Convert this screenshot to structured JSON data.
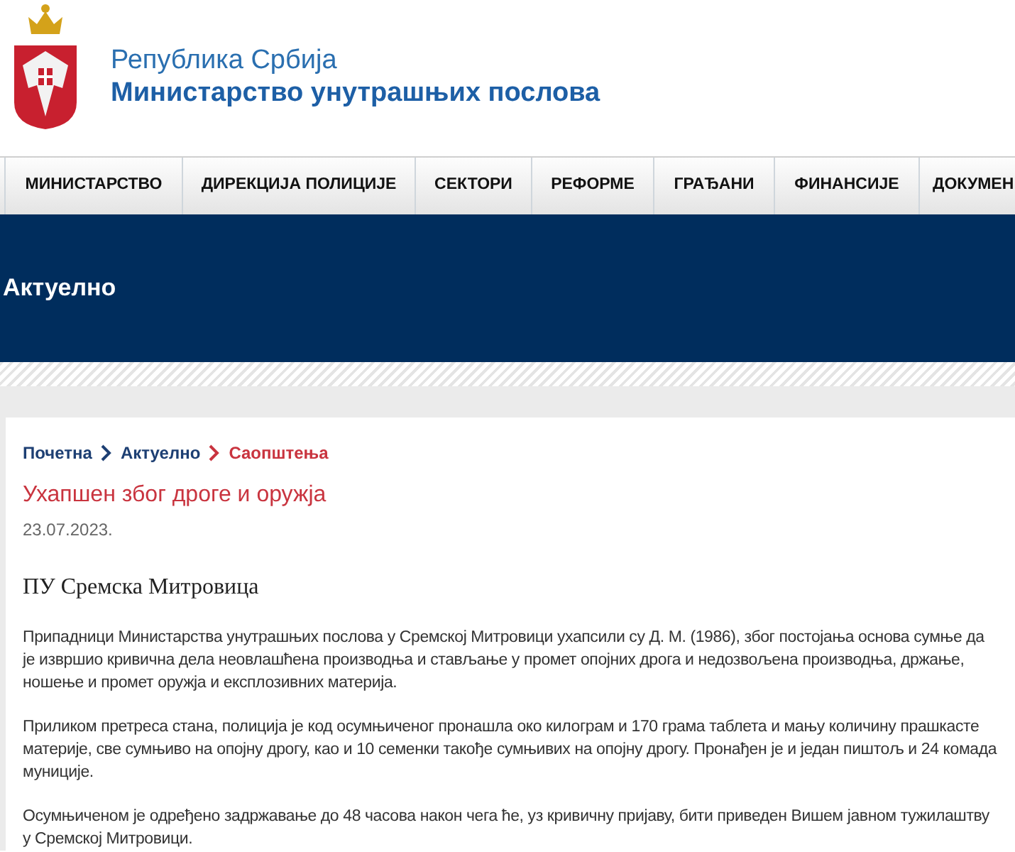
{
  "header": {
    "country": "Република Србија",
    "ministry": "Министарство унутрашњих послова"
  },
  "nav": [
    {
      "label": "МИНИСТАРСТВО"
    },
    {
      "label": "ДИРЕКЦИЈА ПОЛИЦИЈЕ"
    },
    {
      "label": "СЕКТОРИ"
    },
    {
      "label": "РЕФОРМЕ"
    },
    {
      "label": "ГРАЂАНИ"
    },
    {
      "label": "ФИНАНСИЈЕ"
    },
    {
      "label": "ДОКУМЕН"
    }
  ],
  "banner": {
    "title": "Актуелно"
  },
  "breadcrumb": [
    {
      "label": "Почетна",
      "selected": false
    },
    {
      "label": "Актуелно",
      "selected": false
    },
    {
      "label": "Саопштења",
      "selected": true
    }
  ],
  "article": {
    "title": "Ухапшен због дроге и оружја",
    "date": "23.07.2023.",
    "subtitle": "ПУ Сремска Митровица",
    "paragraphs": [
      "Припадници Министарства унутрашњих послова у Сремској Митровици ухапсили су Д. М. (1986), због постојања основа сумње да је извршио кривична дела неовлашћена производња и стављање у промет опојних дрога и недозвољена производња, држање, ношење и промет оружја и експлозивних материја.",
      "Приликом претреса стана, полиција је код осумњиченог пронашла око килограм и 170 грама таблета и мању количину прашкасте материје, све сумњиво на опојну дрогу, као и 10 семенки такође сумњивих на опојну дрогу. Пронађен је и један пиштољ и 24 комада муниције.",
      "Осумњиченом је одређено задржавање до 48 часова након чега ће, уз кривичну пријаву, бити приведен Вишем јавном тужилаштву у Сремској Митровици."
    ]
  }
}
